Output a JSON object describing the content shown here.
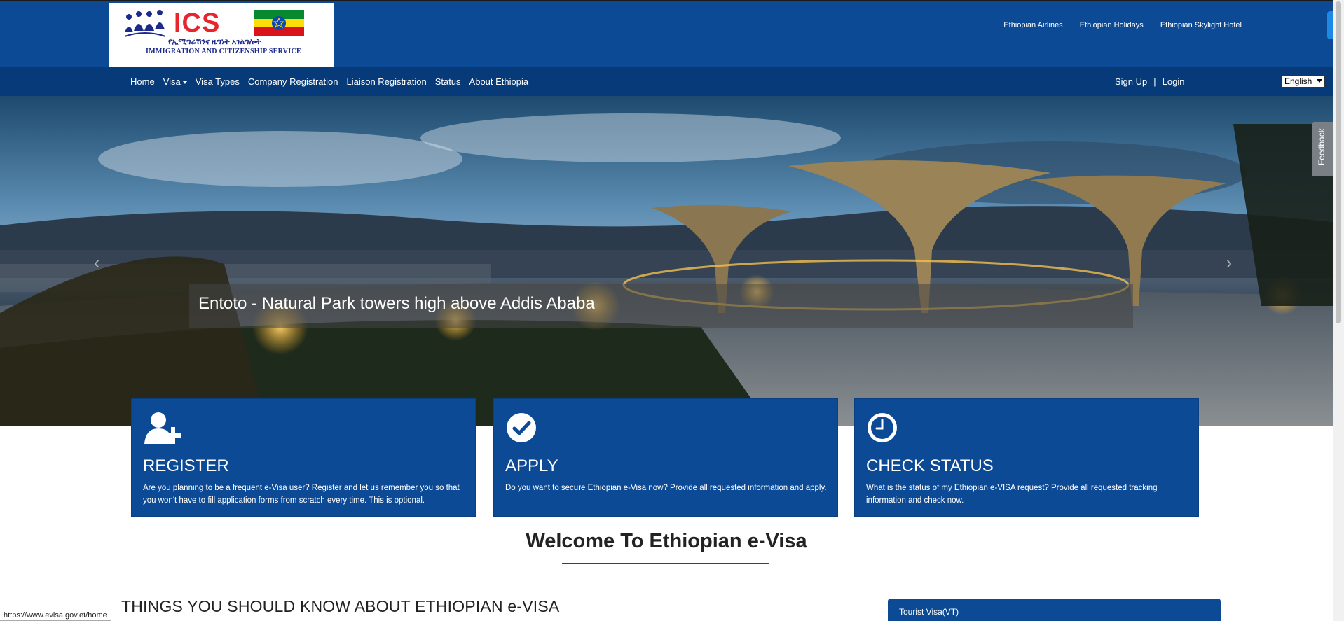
{
  "header": {
    "logo": {
      "brand": "ICS",
      "amharic": "የኢሚግሬሽንና ዜግነት አገልግሎት",
      "service": "IMMIGRATION AND  CITIZENSHIP SERVICE"
    },
    "partners": [
      "Ethiopian Airlines",
      "Ethiopian Holidays",
      "Ethiopian Skylight Hotel"
    ]
  },
  "nav": {
    "items": [
      "Home",
      "Visa",
      "Visa Types",
      "Company Registration",
      "Liaison Registration",
      "Status",
      "About Ethiopia"
    ],
    "sign_up": "Sign Up",
    "separator": "|",
    "login": "Login",
    "language": "English"
  },
  "hero": {
    "caption": "Entoto - Natural Park towers high above Addis Ababa",
    "prev_arrow": "‹",
    "next_arrow": "›",
    "feedback": "Feedback"
  },
  "cards": [
    {
      "icon": "add-user-icon",
      "title": "REGISTER",
      "text": "Are you planning to be a frequent e-Visa user? Register and let us remember you so that you won't have to fill application forms from scratch every time. This is optional."
    },
    {
      "icon": "check-circle-icon",
      "title": "APPLY",
      "text": "Do you want to secure Ethiopian e-Visa now? Provide all requested information and apply."
    },
    {
      "icon": "clock-icon",
      "title": "CHECK STATUS",
      "text": "What is the status of my Ethiopian e-VISA request? Provide all requested tracking information and check now."
    }
  ],
  "welcome": "Welcome To Ethiopian e-Visa",
  "things_heading": "THINGS YOU SHOULD KNOW ABOUT ETHIOPIAN e-VISA",
  "tourist_panel": "Tourist Visa(VT)",
  "status_url": "https://www.evisa.gov.et/home",
  "colors": {
    "primary": "#0c4a96",
    "nav": "#063a78",
    "accent_red": "#e8252c"
  }
}
